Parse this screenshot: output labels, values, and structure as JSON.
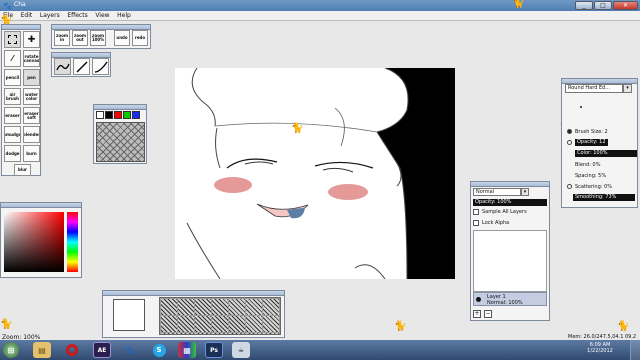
{
  "window": {
    "title": "Cha"
  },
  "menu": [
    "File",
    "Edit",
    "Layers",
    "Effects",
    "View",
    "Help"
  ],
  "view_toolbar": [
    "zoom in",
    "zoom out",
    "zoom 100%",
    "undo",
    "redo"
  ],
  "tools": [
    [
      "",
      "✚"
    ],
    [
      "",
      "rotate canvas"
    ],
    [
      "pencil",
      "pen"
    ],
    [
      "air brush",
      "water color"
    ],
    [
      "eraser",
      "eraser soft"
    ],
    [
      "smudge",
      "blender"
    ],
    [
      "dodge",
      "burn"
    ],
    [
      "blur",
      ""
    ]
  ],
  "palette_colors": [
    "#ffffff",
    "#000000",
    "#ff0000",
    "#00cc00",
    "#1a2bff"
  ],
  "brush_panel": {
    "preset": "Round Hard Ed...",
    "brush_size": "Brush Size: 2",
    "opacity": "Opacity: 12",
    "color": "Color: 100%",
    "blend": "Blend: 0%",
    "spacing": "Spacing: 5%",
    "scattering": "Scattering: 0%",
    "smoothing": "Smoothing: 73%"
  },
  "layers_panel": {
    "blend_mode": "Normal",
    "opacity": "Opacity: 100%",
    "sample_all": "Sample All Layers",
    "lock_alpha": "Lock Alpha",
    "layer_name": "Layer 1",
    "layer_mode": "Normal: 100%"
  },
  "status": {
    "zoom": "Zoom: 100%",
    "memory": "Mem: 26.0/247.5,04.1 09.2"
  },
  "clock": {
    "time": "6:09 AM",
    "date": "1/22/2012"
  },
  "taskbar_apps": [
    "start-orb",
    "explorer",
    "opera",
    "after-effects",
    "paw-app",
    "skype",
    "archive",
    "photoshop",
    "chibipaint"
  ],
  "colors": {
    "accent": "#4f7fb5",
    "blush": "#e08080",
    "canvas_bg": "#000000"
  }
}
